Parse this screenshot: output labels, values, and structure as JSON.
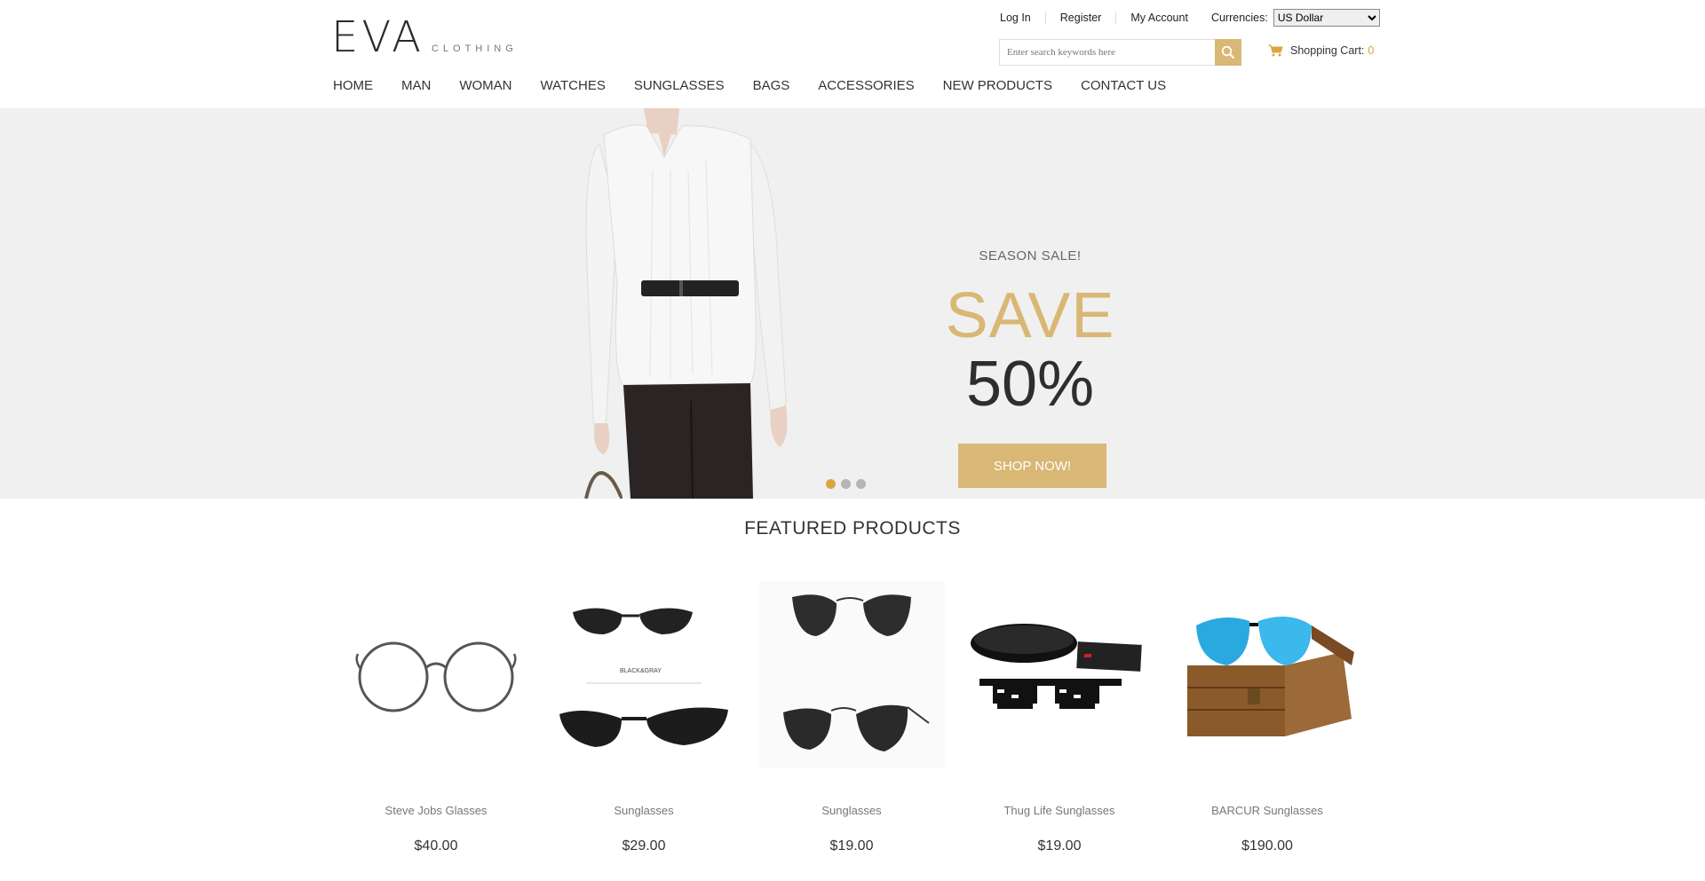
{
  "brand": {
    "name": "EVA",
    "tagline": "CLOTHING"
  },
  "toplinks": {
    "login": "Log In",
    "register": "Register",
    "account": "My Account",
    "currencies_label": "Currencies:",
    "currency_selected": "US Dollar"
  },
  "search": {
    "placeholder": "Enter search keywords here"
  },
  "cart": {
    "label": "Shopping Cart:",
    "count": "0"
  },
  "nav": {
    "items": [
      "HOME",
      "MAN",
      "WOMAN",
      "WATCHES",
      "SUNGLASSES",
      "BAGS",
      "ACCESSORIES",
      "NEW PRODUCTS",
      "CONTACT US"
    ]
  },
  "hero": {
    "eyebrow": "SEASON SALE!",
    "headline": "SAVE",
    "discount": "50%",
    "cta": "SHOP NOW!",
    "active_slide": 1,
    "slides": 3
  },
  "featured": {
    "title": "FEATURED PRODUCTS",
    "products": [
      {
        "name": "Steve Jobs Glasses",
        "price": "$40.00"
      },
      {
        "name": "Sunglasses",
        "price": "$29.00"
      },
      {
        "name": "Sunglasses",
        "price": "$19.00"
      },
      {
        "name": "Thug Life Sunglasses",
        "price": "$19.00"
      },
      {
        "name": "BARCUR Sunglasses",
        "price": "$190.00"
      }
    ],
    "product2_caption": "BLACK&GRAY"
  },
  "colors": {
    "accent": "#d9b774",
    "dot_active": "#d9a641"
  }
}
